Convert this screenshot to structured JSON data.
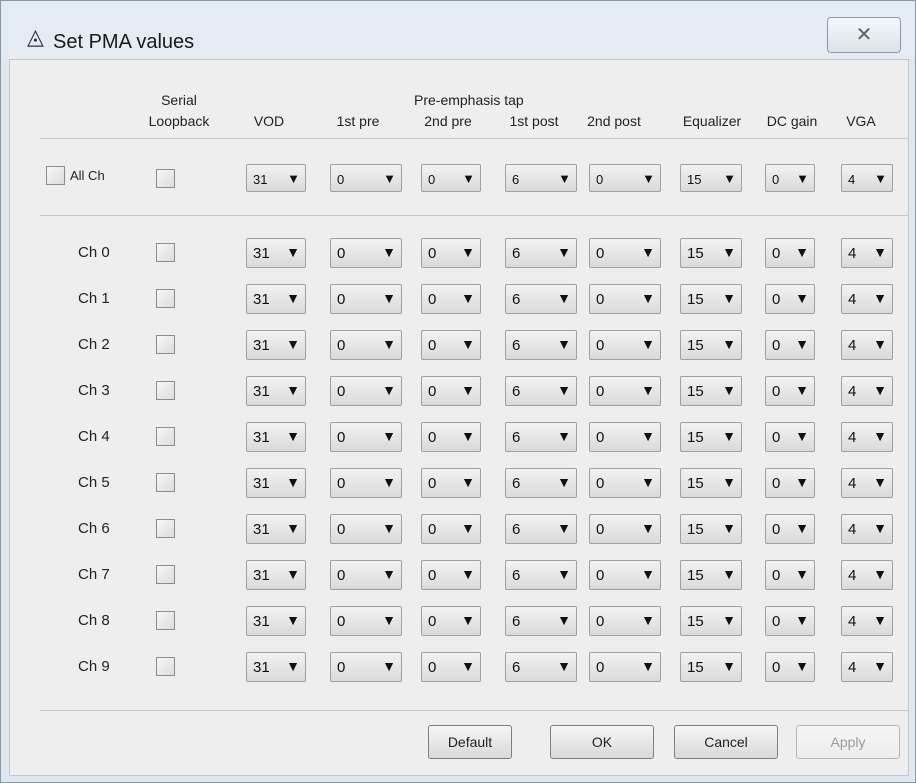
{
  "window": {
    "title": "Set PMA values",
    "app_icon": "triangle-logo-icon",
    "close_glyph": "✕"
  },
  "headers": {
    "serial": "Serial",
    "loopback": "Loopback",
    "vod": "VOD",
    "pre1": "1st pre",
    "pre_emphasis_tap": "Pre-emphasis tap",
    "pre2": "2nd pre",
    "post1": "1st post",
    "post2": "2nd post",
    "equalizer": "Equalizer",
    "dc_gain": "DC gain",
    "vga": "VGA"
  },
  "all_ch": {
    "label": "All Ch",
    "checked": false,
    "values": {
      "vod": "31",
      "pre1": "0",
      "pre2": "0",
      "post1": "6",
      "post2": "0",
      "equalizer": "15",
      "dc_gain": "0",
      "vga": "4"
    }
  },
  "channels": [
    {
      "label": "Ch 0",
      "loopback": false,
      "vod": "31",
      "pre1": "0",
      "pre2": "0",
      "post1": "6",
      "post2": "0",
      "equalizer": "15",
      "dc_gain": "0",
      "vga": "4"
    },
    {
      "label": "Ch 1",
      "loopback": false,
      "vod": "31",
      "pre1": "0",
      "pre2": "0",
      "post1": "6",
      "post2": "0",
      "equalizer": "15",
      "dc_gain": "0",
      "vga": "4"
    },
    {
      "label": "Ch 2",
      "loopback": false,
      "vod": "31",
      "pre1": "0",
      "pre2": "0",
      "post1": "6",
      "post2": "0",
      "equalizer": "15",
      "dc_gain": "0",
      "vga": "4"
    },
    {
      "label": "Ch 3",
      "loopback": false,
      "vod": "31",
      "pre1": "0",
      "pre2": "0",
      "post1": "6",
      "post2": "0",
      "equalizer": "15",
      "dc_gain": "0",
      "vga": "4"
    },
    {
      "label": "Ch 4",
      "loopback": false,
      "vod": "31",
      "pre1": "0",
      "pre2": "0",
      "post1": "6",
      "post2": "0",
      "equalizer": "15",
      "dc_gain": "0",
      "vga": "4"
    },
    {
      "label": "Ch 5",
      "loopback": false,
      "vod": "31",
      "pre1": "0",
      "pre2": "0",
      "post1": "6",
      "post2": "0",
      "equalizer": "15",
      "dc_gain": "0",
      "vga": "4"
    },
    {
      "label": "Ch 6",
      "loopback": false,
      "vod": "31",
      "pre1": "0",
      "pre2": "0",
      "post1": "6",
      "post2": "0",
      "equalizer": "15",
      "dc_gain": "0",
      "vga": "4"
    },
    {
      "label": "Ch 7",
      "loopback": false,
      "vod": "31",
      "pre1": "0",
      "pre2": "0",
      "post1": "6",
      "post2": "0",
      "equalizer": "15",
      "dc_gain": "0",
      "vga": "4"
    },
    {
      "label": "Ch 8",
      "loopback": false,
      "vod": "31",
      "pre1": "0",
      "pre2": "0",
      "post1": "6",
      "post2": "0",
      "equalizer": "15",
      "dc_gain": "0",
      "vga": "4"
    },
    {
      "label": "Ch 9",
      "loopback": false,
      "vod": "31",
      "pre1": "0",
      "pre2": "0",
      "post1": "6",
      "post2": "0",
      "equalizer": "15",
      "dc_gain": "0",
      "vga": "4"
    }
  ],
  "dropdown_arrow": "▼",
  "buttons": {
    "default": "Default",
    "ok": "OK",
    "cancel": "Cancel",
    "apply": "Apply",
    "apply_enabled": false
  }
}
